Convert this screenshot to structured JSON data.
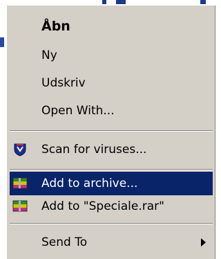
{
  "context_menu": {
    "items": {
      "open": {
        "label": "Åbn"
      },
      "new": {
        "label": "Ny"
      },
      "print": {
        "label": "Udskriv"
      },
      "open_with": {
        "label": "Open With..."
      },
      "scan": {
        "label": "Scan for viruses...",
        "icon": "shield-icon"
      },
      "add_archive": {
        "label": "Add to archive...",
        "icon": "winrar-icon",
        "selected": true
      },
      "add_rar": {
        "label": "Add to \"Speciale.rar\"",
        "icon": "winrar-icon"
      },
      "send_to": {
        "label": "Send To",
        "has_submenu": true
      }
    }
  },
  "colors": {
    "menu_bg": "#d4d0c8",
    "highlight": "#0a246a",
    "highlight_text": "#ffffff"
  }
}
